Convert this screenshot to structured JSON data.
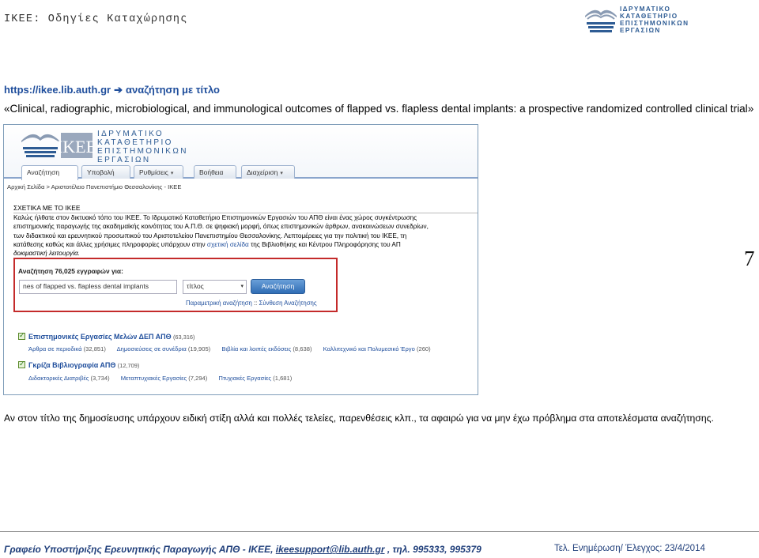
{
  "document": {
    "title": "IKEE: Οδηγίες Καταχώρησης",
    "logo": {
      "lines": [
        "ΙΔΡΥΜΑΤΙΚΟ",
        "ΚΑΤΑΘΕΤΗΡΙΟ",
        "ΕΠΙΣΤΗΜΟΝΙΚΩΝ",
        "ΕΡΓΑΣΙΩΝ"
      ],
      "mark": "IKEE"
    },
    "url_line": {
      "url": "https://ikee.lib.auth.gr",
      "arrow": "➔",
      "text": "αναζήτηση με τίτλο"
    },
    "title_line": "«Clinical, radiographic, microbiological, and immunological outcomes of flapped vs. flapless dental implants: a prospective randomized controlled clinical trial»",
    "page_number": "7",
    "note": "Αν στον τίτλο της δημοσίευσης υπάρχουν ειδική στίξη αλλά και πολλές τελείες, παρενθέσεις κλπ., τα αφαιρώ για να μην έχω πρόβλημα στα αποτελέσματα αναζήτησης.",
    "footer": {
      "left_prefix": "Γραφείο Υποστήριξης Ερευνητικής Παραγωγής ΑΠΘ - ΙΚΕΕ, ",
      "email": "ikeesupport@lib.auth.gr",
      "left_suffix": " , τηλ. 995333, 995379",
      "right": "Τελ. Ενημέρωση/ Έλεγχος: 23/4/2014"
    }
  },
  "screenshot": {
    "logo_lines": [
      "ΙΔΡΥΜΑΤΙΚΟ",
      "ΚΑΤΑΘΕΤΗΡΙΟ",
      "ΕΠΙΣΤΗΜΟΝΙΚΩΝ",
      "ΕΡΓΑΣΙΩΝ"
    ],
    "logo_mark": "IKEE",
    "nav": [
      {
        "label": "Αναζήτηση",
        "active": true,
        "dropdown": false
      },
      {
        "label": "Υποβολή",
        "active": false,
        "dropdown": false
      },
      {
        "label": "Ρυθμίσεις",
        "active": false,
        "dropdown": true
      },
      {
        "label": "Βοήθεια",
        "active": false,
        "dropdown": false
      },
      {
        "label": "Διαχείριση",
        "active": false,
        "dropdown": true
      }
    ],
    "dropdown_caret": "▾",
    "breadcrumb": "Αρχική Σελίδα > Αριστοτέλειο Πανεπιστήμιο Θεσσαλονίκης - ΙΚΕΕ",
    "about_heading": "ΣΧΕΤΙΚΑ ΜΕ ΤΟ ΙΚΕΕ",
    "about_lines": [
      "Καλώς ήλθατε στον δικτυακό τόπο του ΙΚΕΕ. Το Ιδρυματικό Καταθετήριο Επιστημονικών Εργασιών του ΑΠΘ είναι ένας χώρος συγκέντρωσης",
      "επιστημονικής παραγωγής της ακαδημαϊκής κοινότητας του Α.Π.Θ. σε ψηφιακή μορφή, όπως επιστημονικών άρθρων, ανακοινώσεων συνεδρίων,",
      "των διδακτικού και ερευνητικού προσωπικού του Αριστοτελείου Πανεπιστημίου Θεσσαλονίκης. Λεπτομέρειες για την πολιτική του ΙΚΕΕ, τη",
      "κατάθεσης καθώς και άλλες χρήσιμες πληροφορίες υπάρχουν στην",
      "σχετική σελίδα",
      "της Βιβλιοθήκης και Κέντρου Πληροφόρησης του ΑΠ",
      "δοκιμαστική λειτουργία."
    ],
    "search": {
      "label": "Αναζήτηση 76,025 εγγραφών για:",
      "input_value": "nes of flapped vs. flapless dental implants",
      "field_value": "τίτλος",
      "field_caret": "▾",
      "button_label": "Αναζήτηση",
      "advanced_link": "Παραμετρική αναζήτηση",
      "separator": "::",
      "compose_link": "Σύνθεση Αναζήτησης"
    },
    "collections": [
      {
        "name": "Επιστημονικές Εργασίες Μελών ΔΕΠ ΑΠΘ",
        "count": "(63,316)",
        "subcollections": [
          {
            "name": "Άρθρα σε περιοδικά",
            "count": "(32,851)"
          },
          {
            "name": "Δημοσιεύσεις σε συνέδρια",
            "count": "(19,905)"
          },
          {
            "name": "Βιβλία και λοιπές εκδόσεις",
            "count": "(8,638)"
          },
          {
            "name": "Καλλιτεχνικό και Πολυμεσικό Έργο",
            "count": "(260)"
          }
        ]
      },
      {
        "name": "Γκρίζα Βιβλιογραφία ΑΠΘ",
        "count": "(12,709)",
        "subcollections": [
          {
            "name": "Διδακτορικές Διατριβές",
            "count": "(3,734)"
          },
          {
            "name": "Μεταπτυχιακές Εργασίες",
            "count": "(7,294)"
          },
          {
            "name": "Πτυχιακές Εργασίες",
            "count": "(1,681)"
          }
        ]
      }
    ]
  },
  "colors": {
    "link_blue": "#1f4e9c",
    "highlight_red": "#c42b2b",
    "footer_blue": "#1f3e7a",
    "button_blue": "#2f6db5"
  }
}
